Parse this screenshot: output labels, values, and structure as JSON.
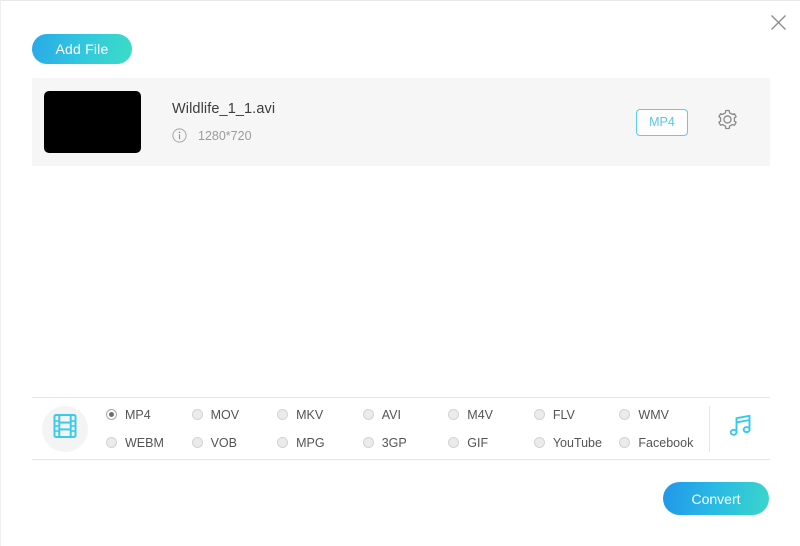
{
  "window": {
    "close_label": "×"
  },
  "toolbar": {
    "add_file_label": "Add File"
  },
  "file_list": {
    "items": [
      {
        "name": "Wildlife_1_1.avi",
        "resolution": "1280*720",
        "output_format": "MP4"
      }
    ]
  },
  "format_bar": {
    "video_icon": "film-strip-icon",
    "audio_icon": "music-note-icon",
    "selected": "MP4",
    "options": [
      "MP4",
      "MOV",
      "MKV",
      "AVI",
      "M4V",
      "FLV",
      "WMV",
      "WEBM",
      "VOB",
      "MPG",
      "3GP",
      "GIF",
      "YouTube",
      "Facebook"
    ]
  },
  "footer": {
    "convert_label": "Convert"
  },
  "colors": {
    "accent_cyan": "#5bc6ea",
    "gradient_start": "#2196e8",
    "gradient_end": "#3ad6cb",
    "row_bg": "#f6f6f6"
  }
}
